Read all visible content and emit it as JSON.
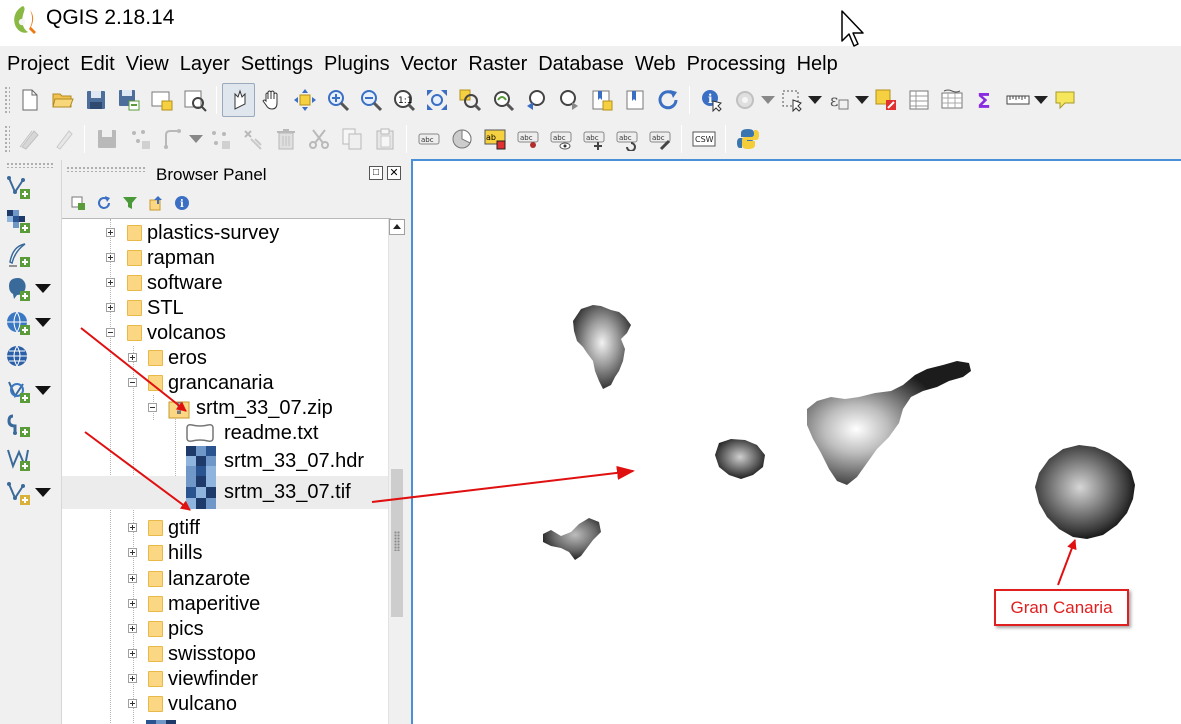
{
  "app": {
    "title": "QGIS 2.18.14",
    "logo_icon": "qgis-logo-icon",
    "accent_color": "#4a90d9"
  },
  "menu": {
    "items": [
      "Project",
      "Edit",
      "View",
      "Layer",
      "Settings",
      "Plugins",
      "Vector",
      "Raster",
      "Database",
      "Web",
      "Processing",
      "Help"
    ]
  },
  "toolbars": {
    "map_navigation_icons": [
      "new-project-icon",
      "open-project-icon",
      "save-project-icon",
      "save-as-icon",
      "new-print-composer-icon",
      "composer-manager-icon",
      "pan-map-icon",
      "pan-hand-icon",
      "pan-to-selection-icon",
      "zoom-in-icon",
      "zoom-out-icon",
      "zoom-native-icon",
      "zoom-full-icon",
      "zoom-to-selection-icon",
      "zoom-to-layer-icon",
      "zoom-last-icon",
      "zoom-next-icon",
      "new-bookmark-icon",
      "show-bookmarks-icon",
      "refresh-icon",
      "identify-icon",
      "run-feature-action-icon",
      "select-features-icon",
      "select-by-expression-icon",
      "deselect-icon",
      "attribute-table-icon",
      "field-calculator-icon",
      "statistics-icon",
      "measure-icon",
      "map-tips-icon"
    ],
    "digitizing_icons": [
      "current-edits-icon",
      "toggle-editing-icon",
      "save-edits-icon",
      "add-feature-icon",
      "move-feature-icon",
      "node-tool-icon",
      "delete-selected-icon",
      "cut-features-icon",
      "copy-features-icon",
      "paste-features-icon",
      "layer-labeling-icon",
      "layer-diagram-icon",
      "highlight-pinned-labels-icon",
      "pin-labels-icon",
      "show-hide-labels-icon",
      "move-label-icon",
      "rotate-label-icon",
      "change-label-icon",
      "csw-icon",
      "python-console-icon"
    ],
    "csw_label": "CSW"
  },
  "browser_panel": {
    "title": "Browser Panel",
    "float_button": "□",
    "close_button": "✕",
    "tool_icons": [
      "add-selected-layers-icon",
      "refresh-icon",
      "filter-icon",
      "collapse-all-icon",
      "properties-icon"
    ],
    "tree": [
      {
        "label": "plastics-survey",
        "type": "folder",
        "depth": 0,
        "expanded": false
      },
      {
        "label": "rapman",
        "type": "folder",
        "depth": 0,
        "expanded": false
      },
      {
        "label": "software",
        "type": "folder",
        "depth": 0,
        "expanded": false
      },
      {
        "label": "STL",
        "type": "folder",
        "depth": 0,
        "expanded": false
      },
      {
        "label": "volcanos",
        "type": "folder",
        "depth": 0,
        "expanded": true
      },
      {
        "label": "eros",
        "type": "folder",
        "depth": 1,
        "expanded": false
      },
      {
        "label": "grancanaria",
        "type": "folder",
        "depth": 1,
        "expanded": true
      },
      {
        "label": "srtm_33_07.zip",
        "type": "zip",
        "depth": 2,
        "expanded": true
      },
      {
        "label": "readme.txt",
        "type": "text-file",
        "depth": 3
      },
      {
        "label": "srtm_33_07.hdr",
        "type": "raster",
        "depth": 3
      },
      {
        "label": "srtm_33_07.tif",
        "type": "raster",
        "depth": 3,
        "selected": true
      },
      {
        "label": "gtiff",
        "type": "folder",
        "depth": 1,
        "expanded": false
      },
      {
        "label": "hills",
        "type": "folder",
        "depth": 1,
        "expanded": false
      },
      {
        "label": "lanzarote",
        "type": "folder",
        "depth": 1,
        "expanded": false
      },
      {
        "label": "maperitive",
        "type": "folder",
        "depth": 1,
        "expanded": false
      },
      {
        "label": "pics",
        "type": "folder",
        "depth": 1,
        "expanded": false
      },
      {
        "label": "swisstopo",
        "type": "folder",
        "depth": 1,
        "expanded": false
      },
      {
        "label": "viewfinder",
        "type": "folder",
        "depth": 1,
        "expanded": false
      },
      {
        "label": "vulcano",
        "type": "folder",
        "depth": 1,
        "expanded": false
      }
    ]
  },
  "layer_toolbar": {
    "icons": [
      "add-vector-layer-icon",
      "add-raster-layer-icon",
      "add-delimited-text-icon",
      "add-postgis-layer-icon",
      "add-spatialite-layer-icon",
      "add-wms-layer-icon",
      "add-wfs-layer-icon",
      "add-virtual-layer-icon",
      "add-oracle-layer-icon",
      "add-mssql-layer-icon"
    ]
  },
  "map": {
    "annotation": {
      "text": "Gran Canaria",
      "color": "#e02020"
    },
    "islands": [
      "la-palma",
      "tenerife",
      "la-gomera",
      "el-hierro",
      "gran-canaria"
    ]
  }
}
